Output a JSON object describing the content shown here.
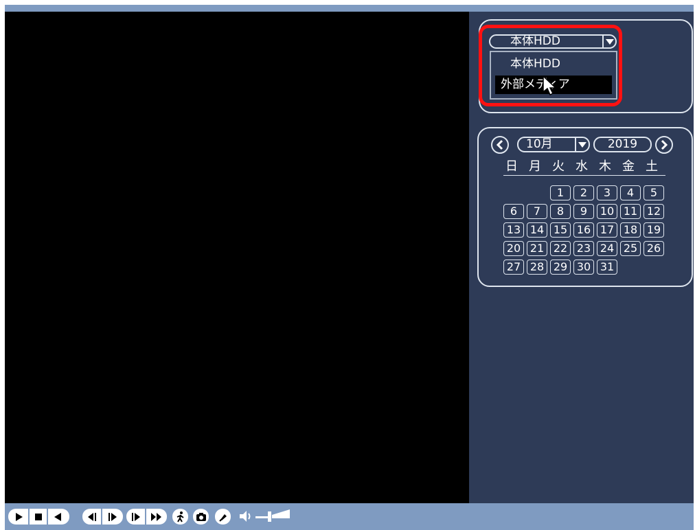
{
  "storage": {
    "selected": "本体HDD",
    "options": [
      "本体HDD",
      "外部メディア"
    ]
  },
  "calendar": {
    "month": "10月",
    "year": "2019",
    "weekdays": [
      "日",
      "月",
      "火",
      "水",
      "木",
      "金",
      "土"
    ],
    "days": [
      "1",
      "2",
      "3",
      "4",
      "5",
      "6",
      "7",
      "8",
      "9",
      "10",
      "11",
      "12",
      "13",
      "14",
      "15",
      "16",
      "17",
      "18",
      "19",
      "20",
      "21",
      "22",
      "23",
      "24",
      "25",
      "26",
      "27",
      "28",
      "29",
      "30",
      "31"
    ]
  },
  "toolbar": {
    "icons": [
      "play-icon",
      "stop-icon",
      "reverse-play-icon",
      "step-back-icon",
      "step-forward-icon",
      "slow-play-icon",
      "fast-forward-icon",
      "smart-search-icon",
      "snapshot-icon",
      "tag-icon",
      "volume-icon"
    ]
  },
  "colors": {
    "sidebar_bg": "#2e3b57",
    "frame_blue": "#7f9bc1",
    "highlight": "#ff1111"
  }
}
